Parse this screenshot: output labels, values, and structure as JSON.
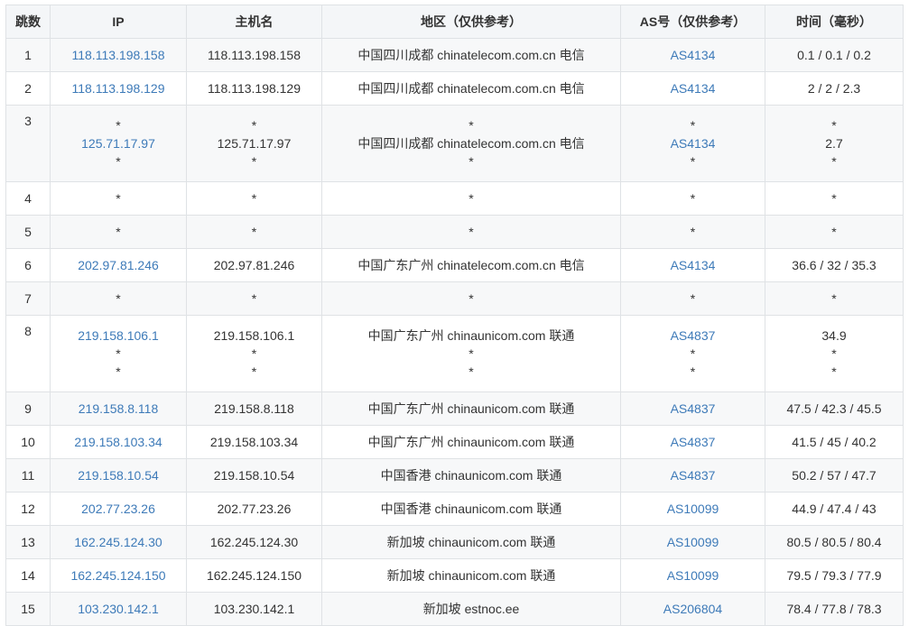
{
  "headers": {
    "hop": "跳数",
    "ip": "IP",
    "host": "主机名",
    "region": "地区（仅供参考）",
    "as": "AS号（仅供参考）",
    "time": "时间（毫秒）"
  },
  "rows": [
    {
      "hop": "1",
      "ip": [
        "118.113.198.158"
      ],
      "host": [
        "118.113.198.158"
      ],
      "region": [
        "中国四川成都 chinatelecom.com.cn 电信"
      ],
      "as": [
        "AS4134"
      ],
      "time": [
        "0.1 / 0.1 / 0.2"
      ]
    },
    {
      "hop": "2",
      "ip": [
        "118.113.198.129"
      ],
      "host": [
        "118.113.198.129"
      ],
      "region": [
        "中国四川成都 chinatelecom.com.cn 电信"
      ],
      "as": [
        "AS4134"
      ],
      "time": [
        "2 / 2 / 2.3"
      ]
    },
    {
      "hop": "3",
      "ip": [
        "*",
        "125.71.17.97",
        "*"
      ],
      "host": [
        "*",
        "125.71.17.97",
        "*"
      ],
      "region": [
        "*",
        "中国四川成都 chinatelecom.com.cn 电信",
        "*"
      ],
      "as": [
        "*",
        "AS4134",
        "*"
      ],
      "time": [
        "*",
        "2.7",
        "*"
      ]
    },
    {
      "hop": "4",
      "ip": [
        "*"
      ],
      "host": [
        "*"
      ],
      "region": [
        "*"
      ],
      "as": [
        "*"
      ],
      "time": [
        "*"
      ]
    },
    {
      "hop": "5",
      "ip": [
        "*"
      ],
      "host": [
        "*"
      ],
      "region": [
        "*"
      ],
      "as": [
        "*"
      ],
      "time": [
        "*"
      ]
    },
    {
      "hop": "6",
      "ip": [
        "202.97.81.246"
      ],
      "host": [
        "202.97.81.246"
      ],
      "region": [
        "中国广东广州 chinatelecom.com.cn 电信"
      ],
      "as": [
        "AS4134"
      ],
      "time": [
        "36.6 / 32 / 35.3"
      ]
    },
    {
      "hop": "7",
      "ip": [
        "*"
      ],
      "host": [
        "*"
      ],
      "region": [
        "*"
      ],
      "as": [
        "*"
      ],
      "time": [
        "*"
      ]
    },
    {
      "hop": "8",
      "ip": [
        "219.158.106.1",
        "*",
        "*"
      ],
      "host": [
        "219.158.106.1",
        "*",
        "*"
      ],
      "region": [
        "中国广东广州 chinaunicom.com 联通",
        "*",
        "*"
      ],
      "as": [
        "AS4837",
        "*",
        "*"
      ],
      "time": [
        "34.9",
        "*",
        "*"
      ]
    },
    {
      "hop": "9",
      "ip": [
        "219.158.8.118"
      ],
      "host": [
        "219.158.8.118"
      ],
      "region": [
        "中国广东广州 chinaunicom.com 联通"
      ],
      "as": [
        "AS4837"
      ],
      "time": [
        "47.5 / 42.3 / 45.5"
      ]
    },
    {
      "hop": "10",
      "ip": [
        "219.158.103.34"
      ],
      "host": [
        "219.158.103.34"
      ],
      "region": [
        "中国广东广州 chinaunicom.com 联通"
      ],
      "as": [
        "AS4837"
      ],
      "time": [
        "41.5 / 45 / 40.2"
      ]
    },
    {
      "hop": "11",
      "ip": [
        "219.158.10.54"
      ],
      "host": [
        "219.158.10.54"
      ],
      "region": [
        "中国香港 chinaunicom.com 联通"
      ],
      "as": [
        "AS4837"
      ],
      "time": [
        "50.2 / 57 / 47.7"
      ]
    },
    {
      "hop": "12",
      "ip": [
        "202.77.23.26"
      ],
      "host": [
        "202.77.23.26"
      ],
      "region": [
        "中国香港 chinaunicom.com 联通"
      ],
      "as": [
        "AS10099"
      ],
      "time": [
        "44.9 / 47.4 / 43"
      ]
    },
    {
      "hop": "13",
      "ip": [
        "162.245.124.30"
      ],
      "host": [
        "162.245.124.30"
      ],
      "region": [
        "新加坡 chinaunicom.com 联通"
      ],
      "as": [
        "AS10099"
      ],
      "time": [
        "80.5 / 80.5 / 80.4"
      ]
    },
    {
      "hop": "14",
      "ip": [
        "162.245.124.150"
      ],
      "host": [
        "162.245.124.150"
      ],
      "region": [
        "新加坡 chinaunicom.com 联通"
      ],
      "as": [
        "AS10099"
      ],
      "time": [
        "79.5 / 79.3 / 77.9"
      ]
    },
    {
      "hop": "15",
      "ip": [
        "103.230.142.1"
      ],
      "host": [
        "103.230.142.1"
      ],
      "region": [
        "新加坡 estnoc.ee"
      ],
      "as": [
        "AS206804"
      ],
      "time": [
        "78.4 / 77.8 / 78.3"
      ]
    }
  ],
  "colors": {
    "link": "#3d7ab8",
    "header_bg": "#f4f6f8",
    "row_alt_bg": "#f7f8f9",
    "border": "#dfe2e5"
  }
}
